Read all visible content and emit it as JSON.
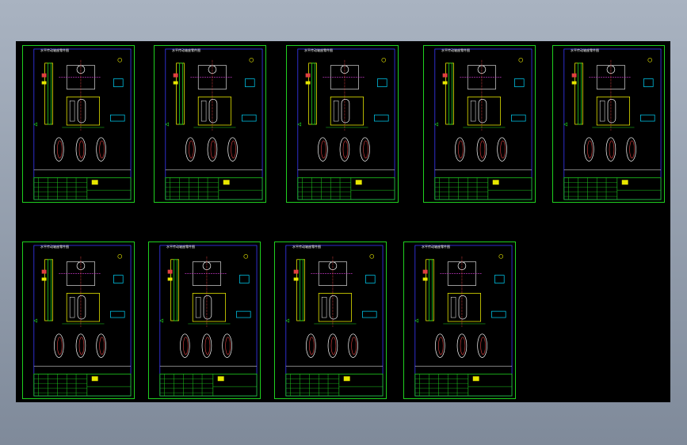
{
  "viewer": {
    "background_color": "#0b0b0b",
    "frame_color": "#1fd01f"
  },
  "sheets": [
    {
      "title": "水平传动轴座零件图"
    },
    {
      "title": "水平传动轴座零件图"
    },
    {
      "title": "水平传动轴座零件图"
    },
    {
      "title": "水平传动轴座零件图"
    },
    {
      "title": "水平传动轴座零件图"
    },
    {
      "title": "水平传动轴座零件图"
    },
    {
      "title": "水平传动轴座零件图"
    },
    {
      "title": "水平传动轴座零件图"
    },
    {
      "title": "水平传动轴座零件图"
    }
  ]
}
